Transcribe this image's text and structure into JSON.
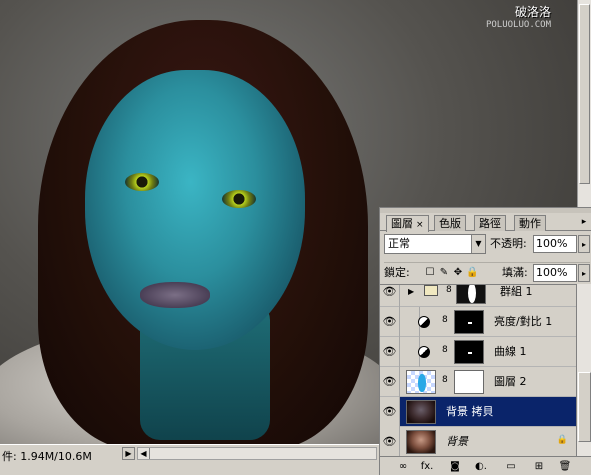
{
  "watermark": {
    "line1": "破洛洛",
    "line2": "POLUOLUO.COM"
  },
  "status_bar": {
    "doc_info": "件: 1.94M/10.6M",
    "arrow": "▶",
    "scroll_left": "◀"
  },
  "layers_panel": {
    "tabs": [
      {
        "label": "圖層",
        "active": true,
        "close": "×"
      },
      {
        "label": "色版",
        "active": false
      },
      {
        "label": "路徑",
        "active": false
      },
      {
        "label": "動作",
        "active": false
      }
    ],
    "menu_button": "▸",
    "blend_mode": "正常",
    "opacity_label": "不透明:",
    "opacity_value": "100%",
    "lock_label": "鎖定:",
    "fill_label": "填滿:",
    "fill_value": "100%",
    "dropdown_arrow": "▼",
    "slider_arrow": "▸",
    "lock_icons": [
      "☐",
      "✎",
      "✥",
      "🔒"
    ],
    "layers": [
      {
        "name": "群組 1",
        "type": "group",
        "visible": true,
        "selected": false
      },
      {
        "name": "亮度/對比 1",
        "type": "adjustment",
        "visible": true,
        "selected": false
      },
      {
        "name": "曲線 1",
        "type": "adjustment",
        "visible": true,
        "selected": false
      },
      {
        "name": "圖層 2",
        "type": "layer-with-mask",
        "visible": true,
        "selected": false
      },
      {
        "name": "背景 拷貝",
        "type": "image",
        "visible": true,
        "selected": true
      },
      {
        "name": "背景",
        "type": "background",
        "visible": true,
        "selected": false,
        "locked": true
      }
    ],
    "eye_glyph": "👁",
    "chain_glyph": "8",
    "group_arrow": "▶",
    "lock_glyph": "🔒",
    "bottom_icons": [
      "link-layers",
      "fx",
      "add-mask",
      "adjustment",
      "new-group",
      "new-layer",
      "delete"
    ],
    "bottom_glyphs": [
      "∞",
      "fx.",
      "◙",
      "◐.",
      "▭",
      "⊞",
      "🗑"
    ]
  },
  "colors": {
    "selected": "#0a246a",
    "chrome": "#d4d0c8"
  }
}
